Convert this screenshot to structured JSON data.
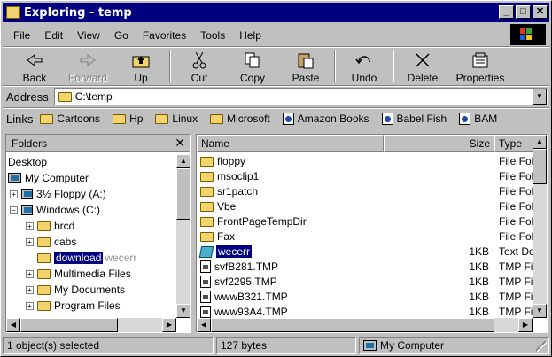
{
  "window": {
    "title": "Exploring - temp"
  },
  "menu": [
    "File",
    "Edit",
    "View",
    "Go",
    "Favorites",
    "Tools",
    "Help"
  ],
  "toolbar": {
    "back": "Back",
    "forward": "Forward",
    "up": "Up",
    "cut": "Cut",
    "copy": "Copy",
    "paste": "Paste",
    "undo": "Undo",
    "delete": "Delete",
    "properties": "Properties"
  },
  "address": {
    "label": "Address",
    "value": "C:\\temp"
  },
  "links": {
    "label": "Links",
    "items": [
      "Cartoons",
      "Hp",
      "Linux",
      "Microsoft",
      "Amazon Books",
      "Babel Fish",
      "BAM"
    ]
  },
  "folders_pane": {
    "title": "Folders",
    "tree": [
      "Desktop",
      "My Computer",
      "3½ Floppy (A:)",
      "Windows (C:)",
      "brcd",
      "cabs",
      "download",
      "Multimedia Files",
      "My Documents",
      "Program Files"
    ],
    "drag_ghost": "wecerr"
  },
  "columns": {
    "name": "Name",
    "size": "Size",
    "type": "Type"
  },
  "files": [
    {
      "name": "floppy",
      "size": "",
      "type": "File Folder",
      "icon": "folder"
    },
    {
      "name": "msoclip1",
      "size": "",
      "type": "File Folder",
      "icon": "folder"
    },
    {
      "name": "sr1patch",
      "size": "",
      "type": "File Folder",
      "icon": "folder"
    },
    {
      "name": "Vbe",
      "size": "",
      "type": "File Folder",
      "icon": "folder"
    },
    {
      "name": "FrontPageTempDir",
      "size": "",
      "type": "File Folder",
      "icon": "folder"
    },
    {
      "name": "Fax",
      "size": "",
      "type": "File Folder",
      "icon": "folder"
    },
    {
      "name": "wecerr",
      "size": "1KB",
      "type": "Text Document",
      "icon": "text"
    },
    {
      "name": "svfB281.TMP",
      "size": "1KB",
      "type": "TMP File",
      "icon": "file"
    },
    {
      "name": "svf2295.TMP",
      "size": "1KB",
      "type": "TMP File",
      "icon": "file"
    },
    {
      "name": "wwwB321.TMP",
      "size": "1KB",
      "type": "TMP File",
      "icon": "file"
    },
    {
      "name": "www93A4.TMP",
      "size": "1KB",
      "type": "TMP File",
      "icon": "file"
    }
  ],
  "status": {
    "selected": "1 object(s) selected",
    "bytes": "127 bytes",
    "location": "My Computer"
  }
}
